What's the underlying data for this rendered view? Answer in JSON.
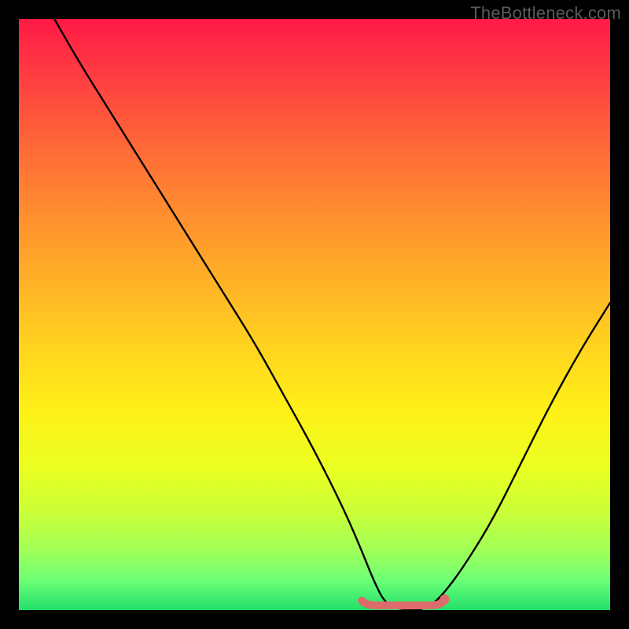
{
  "watermark": "TheBottleneck.com",
  "colors": {
    "curve": "#000000",
    "highlight": "#dd6b6b",
    "gradient_top": "#ff1a46",
    "gradient_bottom": "#22e06a",
    "frame": "#000000"
  },
  "chart_data": {
    "type": "line",
    "title": "",
    "xlabel": "",
    "ylabel": "",
    "xlim": [
      0,
      100
    ],
    "ylim": [
      0,
      100
    ],
    "note": "x is horizontal position (percent across plot), y is bottleneck percentage (0 = optimal/green bottom, 100 = worst/red top). Curve is a V with minimum ~0 around x≈62–69.",
    "series": [
      {
        "name": "bottleneck-curve",
        "x": [
          6,
          10,
          15,
          20,
          25,
          30,
          35,
          40,
          45,
          50,
          55,
          58,
          60,
          62,
          65,
          68,
          70,
          72,
          75,
          80,
          85,
          90,
          95,
          100
        ],
        "y": [
          100,
          93,
          85,
          77,
          69,
          61,
          53,
          45,
          36,
          27,
          17,
          10,
          5,
          1,
          0,
          0,
          1,
          3,
          7,
          15,
          25,
          35,
          44,
          52
        ]
      }
    ],
    "annotations": [
      {
        "name": "optimal-range",
        "kind": "segment",
        "x_start": 58,
        "x_end": 72,
        "y": 0.8,
        "color": "#dd6b6b"
      }
    ]
  }
}
